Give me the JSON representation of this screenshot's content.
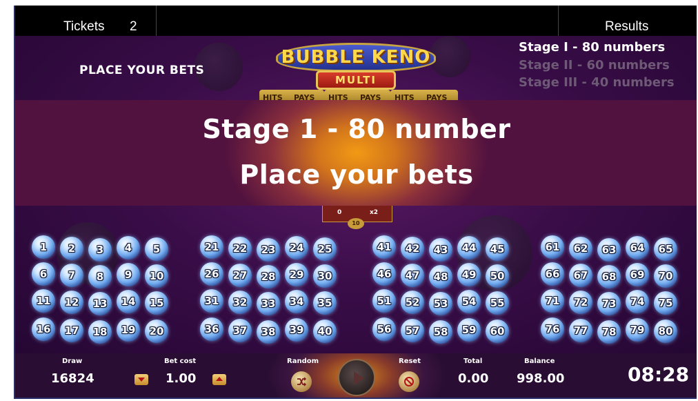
{
  "topbar": {
    "tickets_label": "Tickets",
    "tickets_count": "2",
    "results_label": "Results"
  },
  "header": {
    "status_text": "PLACE YOUR BETS"
  },
  "logo": {
    "title": "BUBBLE KENO",
    "subtitle": "MULTI"
  },
  "paytable_tabs": [
    {
      "hits": "HITS",
      "pays": "PAYS"
    },
    {
      "hits": "HITS",
      "pays": "PAYS"
    },
    {
      "hits": "HITS",
      "pays": "PAYS"
    }
  ],
  "stages": [
    {
      "label": "Stage I - 80 numbers",
      "active": true
    },
    {
      "label": "Stage II - 60 numbers",
      "active": false
    },
    {
      "label": "Stage III - 40 numbers",
      "active": false
    }
  ],
  "banner": {
    "line1": "Stage 1 - 80 number",
    "line2": "Place your bets"
  },
  "payout_box": {
    "hits": "0",
    "multiplier": "x2",
    "badge": "10"
  },
  "balls": [
    "1",
    "2",
    "3",
    "4",
    "5",
    "6",
    "7",
    "8",
    "9",
    "10",
    "11",
    "12",
    "13",
    "14",
    "15",
    "16",
    "17",
    "18",
    "19",
    "20",
    "21",
    "22",
    "23",
    "24",
    "25",
    "26",
    "27",
    "28",
    "29",
    "30",
    "31",
    "32",
    "33",
    "34",
    "35",
    "36",
    "37",
    "38",
    "39",
    "40",
    "41",
    "42",
    "43",
    "44",
    "45",
    "46",
    "47",
    "48",
    "49",
    "50",
    "51",
    "52",
    "53",
    "54",
    "55",
    "56",
    "57",
    "58",
    "59",
    "60",
    "61",
    "62",
    "63",
    "64",
    "65",
    "66",
    "67",
    "68",
    "69",
    "70",
    "71",
    "72",
    "73",
    "74",
    "75",
    "76",
    "77",
    "78",
    "79",
    "80"
  ],
  "bottombar": {
    "draw_label": "Draw",
    "draw_value": "16824",
    "bet_cost_label": "Bet cost",
    "bet_cost_value": "1.00",
    "random_label": "Random",
    "reset_label": "Reset",
    "total_label": "Total",
    "total_value": "0.00",
    "balance_label": "Balance",
    "balance_value": "998.00",
    "clock": "08:28"
  },
  "icons": {
    "bet_down": "triangle-down-icon",
    "bet_up": "triangle-up-icon",
    "random": "shuffle-icon",
    "reset": "no-entry-icon",
    "play": "play-icon"
  },
  "colors": {
    "accent_orange": "#f29a14",
    "background_purple": "#3a0d48",
    "active_stage": "#ffffff",
    "inactive_stage": "#6e5a76"
  }
}
